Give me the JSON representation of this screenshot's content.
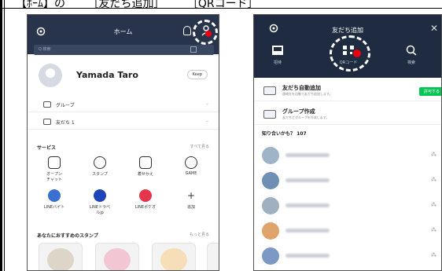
{
  "caption": {
    "left": "【ﾎｰﾑ】の",
    "middle": "［友だち追加］",
    "right": "［QRコード］"
  },
  "home_screen": {
    "title": "ホーム",
    "search_placeholder": "Q 検索",
    "profile_name": "Yamada Taro",
    "keep_label": "Keep",
    "groups_label": "グループ",
    "friends_label": "友だち 1",
    "services_label": "サービス",
    "services_more": "すべて見る",
    "services": [
      {
        "label": "オープン\nチャット",
        "icon": "chat-bubble-icon"
      },
      {
        "label": "スタンプ",
        "icon": "smiley-icon"
      },
      {
        "label": "着せかえ",
        "icon": "theme-icon"
      },
      {
        "label": "GAME",
        "icon": "game-icon"
      },
      {
        "label": "LINEバイト",
        "icon": "line-baito-icon"
      },
      {
        "label": "LINEトラベ\nルjp",
        "icon": "line-travel-icon"
      },
      {
        "label": "LINEポケオ",
        "icon": "line-pokeo-icon"
      },
      {
        "label": "追加",
        "icon": "plus-icon"
      }
    ],
    "stamps_label": "あなたにおすすめのスタンプ",
    "stamps_more": "もっと見る"
  },
  "add_friends_screen": {
    "title": "友だち追加",
    "tabs": [
      "招待",
      "QRコード",
      "検索"
    ],
    "auto_add_title": "友だち自動追加",
    "auto_add_desc": "連絡先を自動で友だち追加します。",
    "allow_label": "許可する",
    "group_title": "グループ作成",
    "group_desc": "友だちとグループを作成します。",
    "suggestions_label": "知り合いかも？ 107"
  },
  "colors": {
    "header_dark": "#27344c",
    "line_green": "#06c755",
    "highlight_red": "#e60012"
  }
}
